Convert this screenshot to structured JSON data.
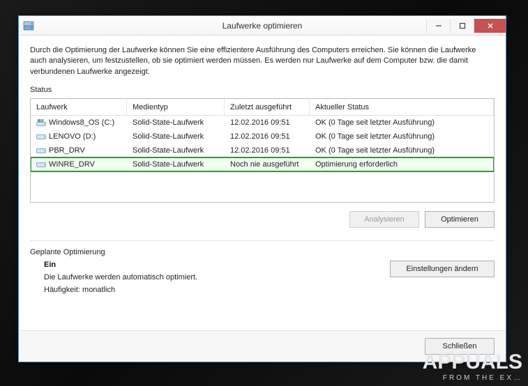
{
  "window": {
    "title": "Laufwerke optimieren"
  },
  "description": "Durch die Optimierung der Laufwerke können Sie eine effizientere Ausführung des Computers erreichen. Sie können die Laufwerke auch analysieren, um festzustellen, ob sie optimiert werden müssen. Es werden nur Laufwerke auf dem Computer bzw. die damit verbundenen Laufwerke angezeigt.",
  "status_label": "Status",
  "columns": {
    "drive": "Laufwerk",
    "media": "Medientyp",
    "last": "Zuletzt ausgeführt",
    "status": "Aktueller Status"
  },
  "rows": [
    {
      "drive": "Windows8_OS (C:)",
      "media": "Solid-State-Laufwerk",
      "last": "12.02.2016 09:51",
      "status": "OK (0 Tage seit letzter Ausführung)",
      "icon": "os"
    },
    {
      "drive": "LENOVO (D:)",
      "media": "Solid-State-Laufwerk",
      "last": "12.02.2016 09:51",
      "status": "OK (0 Tage seit letzter Ausführung)",
      "icon": "hdd"
    },
    {
      "drive": "PBR_DRV",
      "media": "Solid-State-Laufwerk",
      "last": "12.02.2016 09:51",
      "status": "OK (0 Tage seit letzter Ausführung)",
      "icon": "hdd"
    },
    {
      "drive": "WINRE_DRV",
      "media": "Solid-State-Laufwerk",
      "last": "Noch nie ausgeführt",
      "status": "Optimierung erforderlich",
      "icon": "hdd",
      "selected": true
    }
  ],
  "buttons": {
    "analyze": "Analysieren",
    "optimize": "Optimieren",
    "change_settings": "Einstellungen ändern",
    "close": "Schließen"
  },
  "scheduled": {
    "heading": "Geplante Optimierung",
    "state": "Ein",
    "desc": "Die Laufwerke werden automatisch optimiert.",
    "freq": "Häufigkeit: monatlich"
  },
  "watermark": {
    "big": "APPUALS",
    "small": "FROM  THE  EX…"
  }
}
